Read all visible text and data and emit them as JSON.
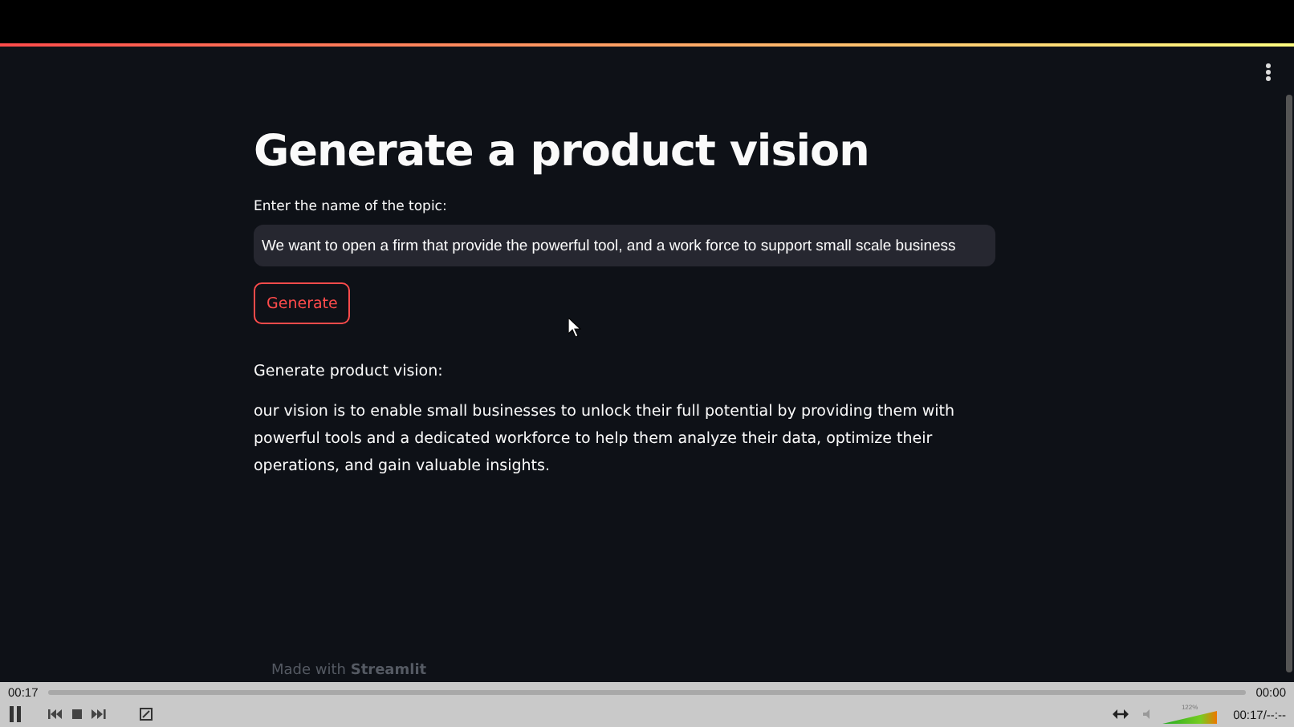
{
  "app": {
    "title": "Generate a product vision",
    "input_label": "Enter the name of the topic:",
    "input_value": "We want to open a firm that provide the powerful tool, and a work force to support small scale business",
    "button": "Generate",
    "output_heading": "Generate product vision:",
    "output_text": "our vision is to enable small businesses to unlock their full potential by providing them with powerful tools and a dedicated workforce to help them analyze their data, optimize their operations, and gain valuable insights.",
    "footer": "Made with **Streamlit**"
  },
  "player": {
    "elapsed": "00:17",
    "total": "00:00",
    "playing": true,
    "volume_label": "122%",
    "volume": {
      "level": 1
    },
    "time_readout": "00:17/--:--"
  }
}
